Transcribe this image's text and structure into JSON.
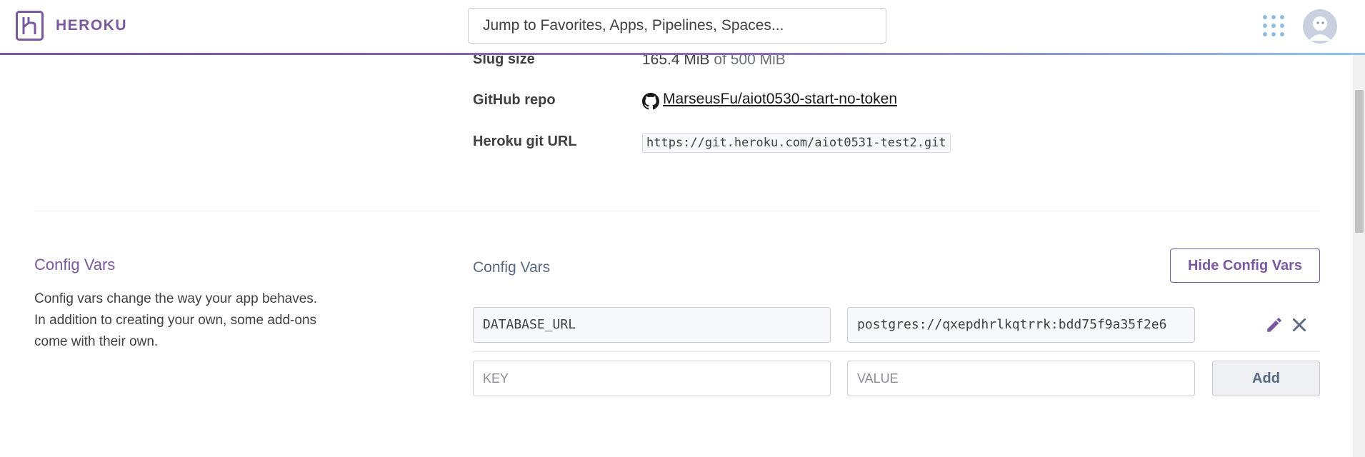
{
  "header": {
    "brand": "HEROKU",
    "search_placeholder": "Jump to Favorites, Apps, Pipelines, Spaces..."
  },
  "info": {
    "slug_label": "Slug size",
    "slug_value": "165.4 MiB",
    "slug_of": "of 500 MiB",
    "github_label": "GitHub repo",
    "github_repo": "MarseusFu/aiot0530-start-no-token",
    "git_url_label": "Heroku git URL",
    "git_url": "https://git.heroku.com/aiot0531-test2.git"
  },
  "config": {
    "section_title": "Config Vars",
    "section_desc": "Config vars change the way your app behaves. In addition to creating your own, some add-ons come with their own.",
    "sub_title": "Config Vars",
    "hide_button": "Hide Config Vars",
    "vars": [
      {
        "key": "DATABASE_URL",
        "value": "postgres://qxepdhrlkqtrrk:bdd75f9a35f2e6"
      }
    ],
    "new_key_placeholder": "KEY",
    "new_value_placeholder": "VALUE",
    "add_button": "Add"
  },
  "colors": {
    "brand": "#79589f",
    "apps_dots": "#8fbde4"
  }
}
